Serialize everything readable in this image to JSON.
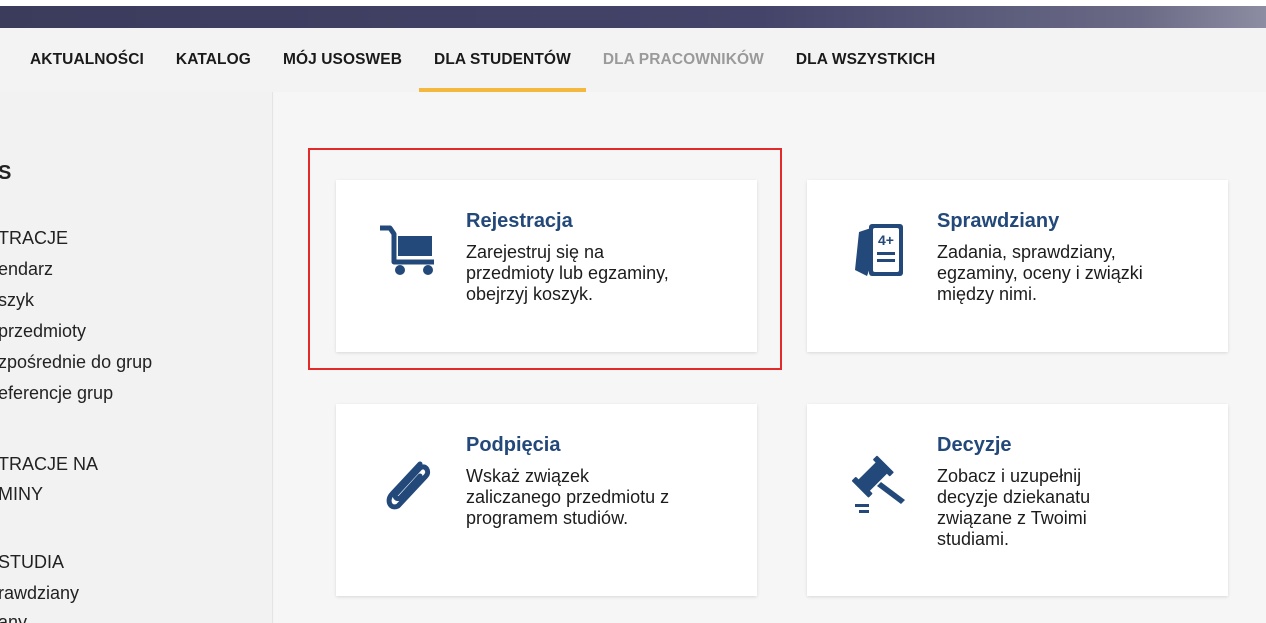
{
  "nav": {
    "items": [
      {
        "label": "AKTUALNOŚCI",
        "state": "normal"
      },
      {
        "label": "KATALOG",
        "state": "normal"
      },
      {
        "label": "MÓJ USOSWEB",
        "state": "normal"
      },
      {
        "label": "DLA STUDENTÓW",
        "state": "active"
      },
      {
        "label": "DLA PRACOWNIKÓW",
        "state": "muted"
      },
      {
        "label": "DLA WSZYSTKICH",
        "state": "normal"
      }
    ],
    "active_color": "#f4b83f"
  },
  "sidebar": {
    "title": "S",
    "sections": [
      {
        "head": "TRACJE",
        "items": [
          "endarz",
          "szyk",
          "przedmioty",
          "zpośrednie do grup",
          "eferencje grup"
        ]
      },
      {
        "head": "TRACJE NA",
        "items": [
          "MINY"
        ]
      },
      {
        "head": "STUDIA",
        "items": [
          "rawdziany",
          "any"
        ]
      }
    ]
  },
  "tiles": [
    {
      "title": "Rejestracja",
      "desc": [
        "Zarejestruj się na",
        "przedmioty lub egzaminy,",
        "obejrzyj koszyk."
      ],
      "icon": "cart-icon"
    },
    {
      "title": "Sprawdziany",
      "desc": [
        "Zadania, sprawdziany,",
        "egzaminy, oceny i związki",
        "między nimi."
      ],
      "icon": "grade-sheet-icon"
    },
    {
      "title": "Podpięcia",
      "desc": [
        "Wskaż związek",
        "zaliczanego przedmiotu z",
        "programem studiów."
      ],
      "icon": "paperclip-icon"
    },
    {
      "title": "Decyzje",
      "desc": [
        "Zobacz i uzupełnij",
        "decyzje dziekanatu",
        "związane z Twoimi",
        "studiami."
      ],
      "icon": "gavel-icon"
    }
  ],
  "grade_badge": "4+",
  "colors": {
    "tile_title": "#23487a",
    "icon": "#23487a",
    "highlight": "#e32a2a"
  }
}
